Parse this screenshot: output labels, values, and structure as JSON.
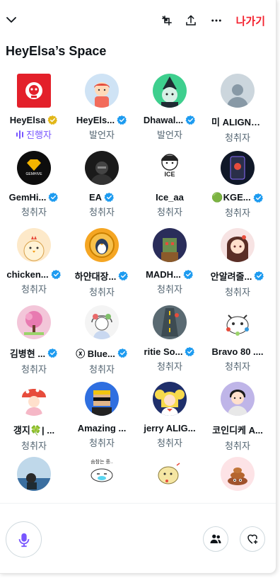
{
  "header": {
    "collapse_icon": "chevron-down-icon",
    "tools": [
      "minimize-icon",
      "share-icon",
      "more-icon"
    ],
    "leave_label": "나가기",
    "space_title": "HeyElsa’s Space"
  },
  "colors": {
    "accent": "#7856ff",
    "leave": "#f4212e",
    "verified": "#1d9bf0",
    "gold": "#e2b719"
  },
  "participants": [
    {
      "name": "HeyElsa",
      "role": "진행자",
      "badge": "gold",
      "avatar": "red-robot-logo"
    },
    {
      "name": "HeyEls...",
      "role": "발언자",
      "badge": "blue",
      "avatar": "cartoon-girl"
    },
    {
      "name": "Dhawal...",
      "role": "발언자",
      "badge": "blue",
      "avatar": "green-wizard"
    },
    {
      "name": "미 ALIGNE...",
      "role": "청취자",
      "badge": "",
      "avatar": "default-person"
    },
    {
      "name": "GemHi...",
      "role": "청취자",
      "badge": "blue",
      "avatar": "gemhive-logo",
      "avatar_text": "GEMHIVE"
    },
    {
      "name": "EA",
      "role": "청취자",
      "badge": "blue",
      "avatar": "dark-figure"
    },
    {
      "name": "Ice_aa",
      "role": "청취자",
      "badge": "",
      "avatar": "ice-boy",
      "avatar_text": "ICE"
    },
    {
      "name": "🟢KGE...",
      "role": "청취자",
      "badge": "blue",
      "avatar": "phone-scene"
    },
    {
      "name": "chicken...",
      "role": "청취자",
      "badge": "blue",
      "avatar": "chicken"
    },
    {
      "name": "하얀대장...",
      "role": "청취자",
      "badge": "blue",
      "avatar": "penguin-coin"
    },
    {
      "name": "MADH...",
      "role": "청취자",
      "badge": "blue",
      "avatar": "pixel-monster"
    },
    {
      "name": "안알려줄...",
      "role": "청취자",
      "badge": "blue",
      "avatar": "anime-girl"
    },
    {
      "name": "김병현 ...",
      "role": "청취자",
      "badge": "blue",
      "avatar": "pink-tree"
    },
    {
      "name": "ⓧ Blue...",
      "role": "청취자",
      "badge": "blue",
      "avatar": "sketch-girl"
    },
    {
      "name": "ritie So...",
      "role": "청취자",
      "badge": "blue",
      "avatar": "road-scene"
    },
    {
      "name": "Bravo 80 ....",
      "role": "청취자",
      "badge": "",
      "avatar": "white-cat"
    },
    {
      "name": "갱지🍀| ...",
      "role": "청취자",
      "badge": "",
      "avatar": "mushroom-girl"
    },
    {
      "name": "Amazing ...",
      "role": "청취자",
      "badge": "",
      "avatar": "pixel-sunglasses"
    },
    {
      "name": "jerry ALIG...",
      "role": "청취자",
      "badge": "",
      "avatar": "sailor-moon"
    },
    {
      "name": "코인디케 A...",
      "role": "청취자",
      "badge": "",
      "avatar": "boy-portrait"
    },
    {
      "name": "",
      "role": "",
      "badge": "",
      "avatar": "car-photo"
    },
    {
      "name": "",
      "role": "",
      "badge": "",
      "avatar": "sleepy-blob",
      "avatar_text": "숨참는 중.."
    },
    {
      "name": "",
      "role": "",
      "badge": "",
      "avatar": "egg-character"
    },
    {
      "name": "",
      "role": "",
      "badge": "",
      "avatar": "poop"
    }
  ],
  "footer": {
    "mic_icon": "microphone-icon",
    "people_icon": "people-icon",
    "heart_icon": "heart-plus-icon"
  }
}
